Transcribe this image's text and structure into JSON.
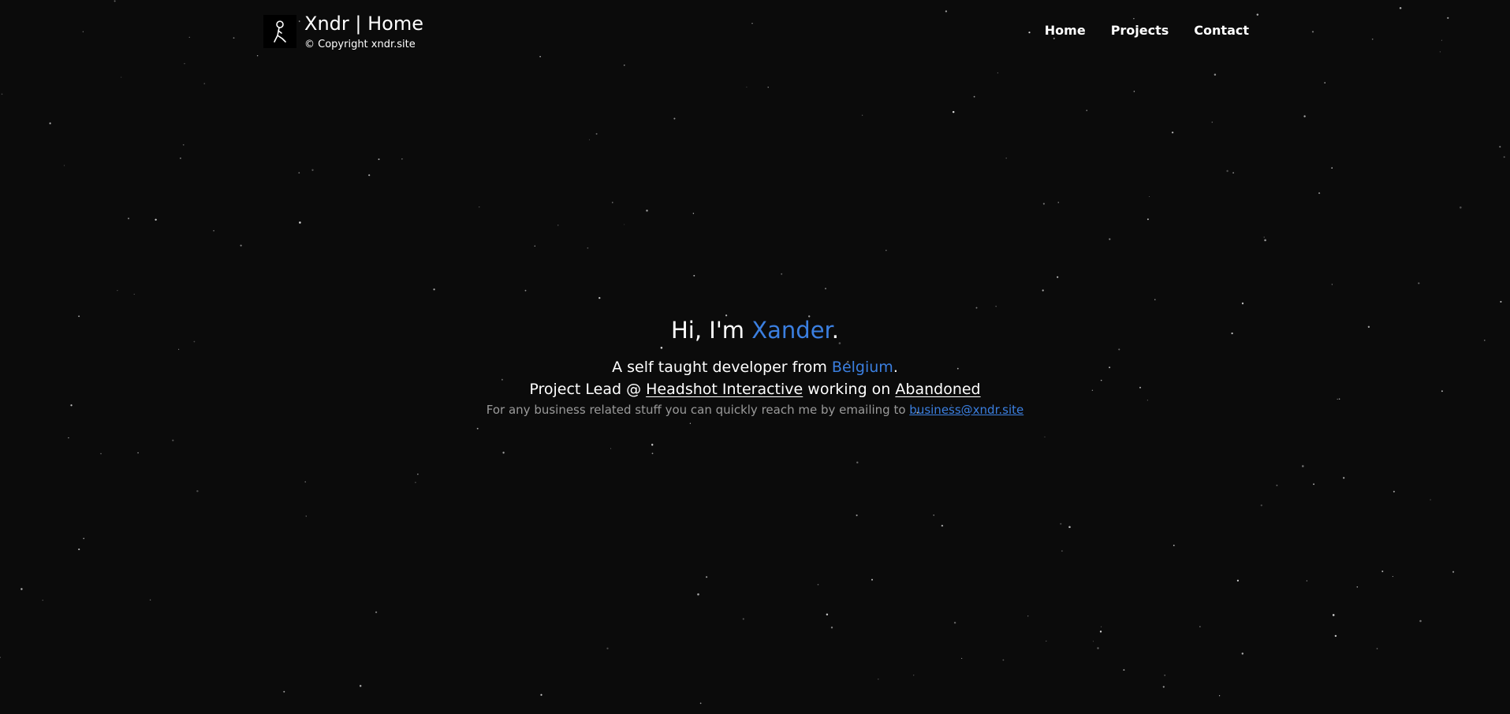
{
  "header": {
    "title": "Xndr | Home",
    "copyright": "© Copyright xndr.site",
    "logo_icon": "stick-figure-icon"
  },
  "nav": {
    "items": [
      "Home",
      "Projects",
      "Contact"
    ]
  },
  "hero": {
    "greeting_prefix": "Hi, I'm ",
    "name": "Xander",
    "greeting_suffix": ".",
    "intro_prefix": "A self taught developer from ",
    "country": "Belgium",
    "intro_suffix": ".",
    "role_prefix": "Project Lead @ ",
    "company": "Headshot Interactive",
    "role_middle": " working on ",
    "project": "Abandoned",
    "contact_prefix": "For any business related stuff you can quickly reach me by emailing to ",
    "email": "business@xndr.site"
  },
  "theme": {
    "background": "#0b0b0b",
    "accent": "#3b7fe0",
    "text": "#ffffff",
    "muted_text": "#9a9a9a"
  }
}
